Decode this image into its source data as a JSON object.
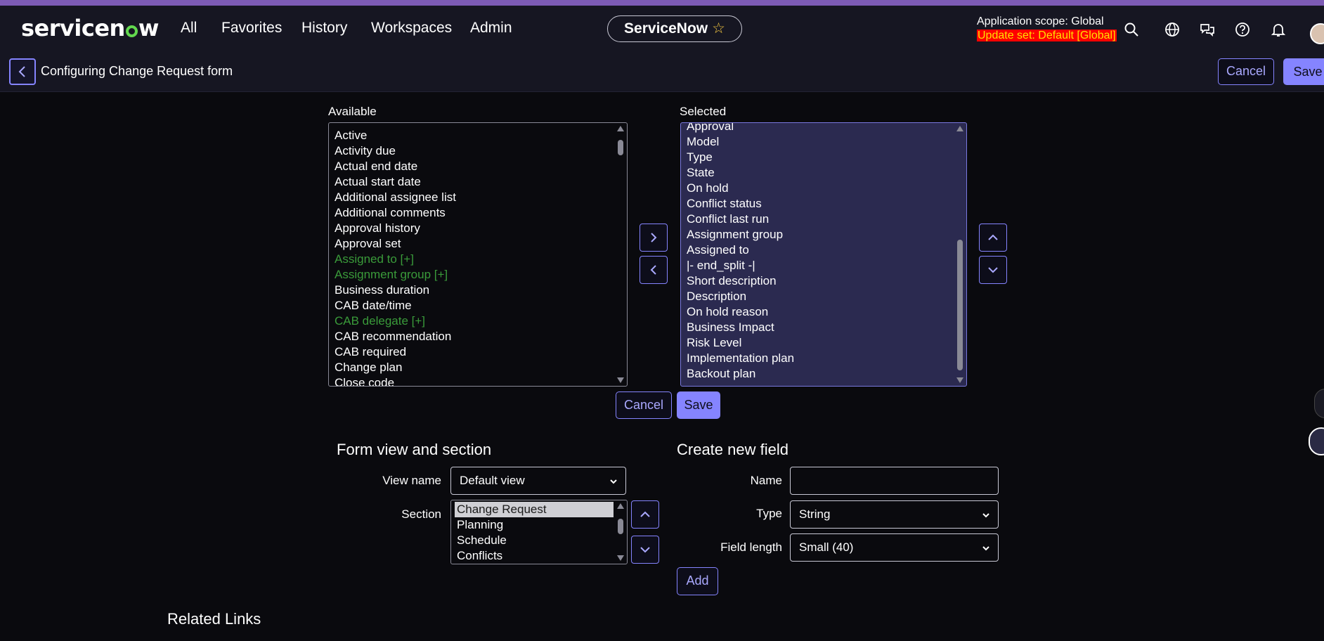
{
  "header": {
    "logo": "servicenow",
    "nav": [
      "All",
      "Favorites",
      "History",
      "Workspaces",
      "Admin"
    ],
    "center_pill": "ServiceNow",
    "scope": "Application scope: Global",
    "update_set": "Update set: Default [Global]",
    "icons": [
      "search-icon",
      "globe-icon",
      "chat-icon",
      "help-icon",
      "bell-icon"
    ]
  },
  "subheader": {
    "title": "Configuring Change Request form",
    "cancel": "Cancel",
    "save": "Save"
  },
  "slushbucket": {
    "available_label": "Available",
    "selected_label": "Selected",
    "available": [
      {
        "text": "Active",
        "green": false
      },
      {
        "text": "Activity due",
        "green": false
      },
      {
        "text": "Actual end date",
        "green": false
      },
      {
        "text": "Actual start date",
        "green": false
      },
      {
        "text": "Additional assignee list",
        "green": false
      },
      {
        "text": "Additional comments",
        "green": false
      },
      {
        "text": "Approval history",
        "green": false
      },
      {
        "text": "Approval set",
        "green": false
      },
      {
        "text": "Assigned to [+]",
        "green": true
      },
      {
        "text": "Assignment group [+]",
        "green": true
      },
      {
        "text": "Business duration",
        "green": false
      },
      {
        "text": "CAB date/time",
        "green": false
      },
      {
        "text": "CAB delegate [+]",
        "green": true
      },
      {
        "text": "CAB recommendation",
        "green": false
      },
      {
        "text": "CAB required",
        "green": false
      },
      {
        "text": "Change plan",
        "green": false
      },
      {
        "text": "Close code",
        "green": false
      }
    ],
    "selected": [
      "Approval",
      "Model",
      "Type",
      "State",
      "On hold",
      "Conflict status",
      "Conflict last run",
      "Assignment group",
      "Assigned to",
      "|- end_split -|",
      "Short description",
      "Description",
      "On hold reason",
      "Business Impact",
      "Risk Level",
      "Implementation plan",
      "Backout plan"
    ],
    "cancel": "Cancel",
    "save": "Save"
  },
  "form_view": {
    "heading": "Form view and section",
    "view_name_label": "View name",
    "view_name_value": "Default view",
    "section_label": "Section",
    "sections": [
      "Change Request",
      "Planning",
      "Schedule",
      "Conflicts"
    ],
    "selected_section": "Change Request"
  },
  "new_field": {
    "heading": "Create new field",
    "name_label": "Name",
    "name_value": "",
    "type_label": "Type",
    "type_value": "String",
    "length_label": "Field length",
    "length_value": "Small (40)",
    "add": "Add"
  },
  "related": {
    "heading": "Related Links"
  }
}
